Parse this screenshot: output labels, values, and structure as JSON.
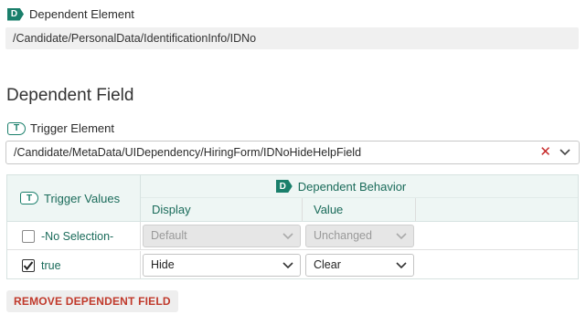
{
  "dependent_element": {
    "badge": "D",
    "label": "Dependent Element",
    "value": "/Candidate/PersonalData/IdentificationInfo/IDNo"
  },
  "dependent_field": {
    "title": "Dependent Field",
    "trigger_element": {
      "badge": "T",
      "label": "Trigger Element",
      "value": "/Candidate/MetaData/UIDependency/HiringForm/IDNoHideHelpField",
      "clear_icon": "close-icon",
      "chevron_icon": "chevron-down-icon"
    },
    "grid": {
      "trigger_header": {
        "badge": "T",
        "label": "Trigger Values"
      },
      "behavior_header": {
        "badge": "D",
        "label": "Dependent Behavior"
      },
      "display_header": "Display",
      "value_header": "Value",
      "rows": [
        {
          "trigger": "-No Selection-",
          "checked": false,
          "display": "Default",
          "value": "Unchanged",
          "disabled": true
        },
        {
          "trigger": "true",
          "checked": true,
          "display": "Hide",
          "value": "Clear",
          "disabled": false
        }
      ]
    },
    "remove_button": "REMOVE DEPENDENT FIELD"
  },
  "colors": {
    "accent": "#1a7f6b",
    "header_bg": "#eef6f4",
    "danger": "#c0392b"
  }
}
